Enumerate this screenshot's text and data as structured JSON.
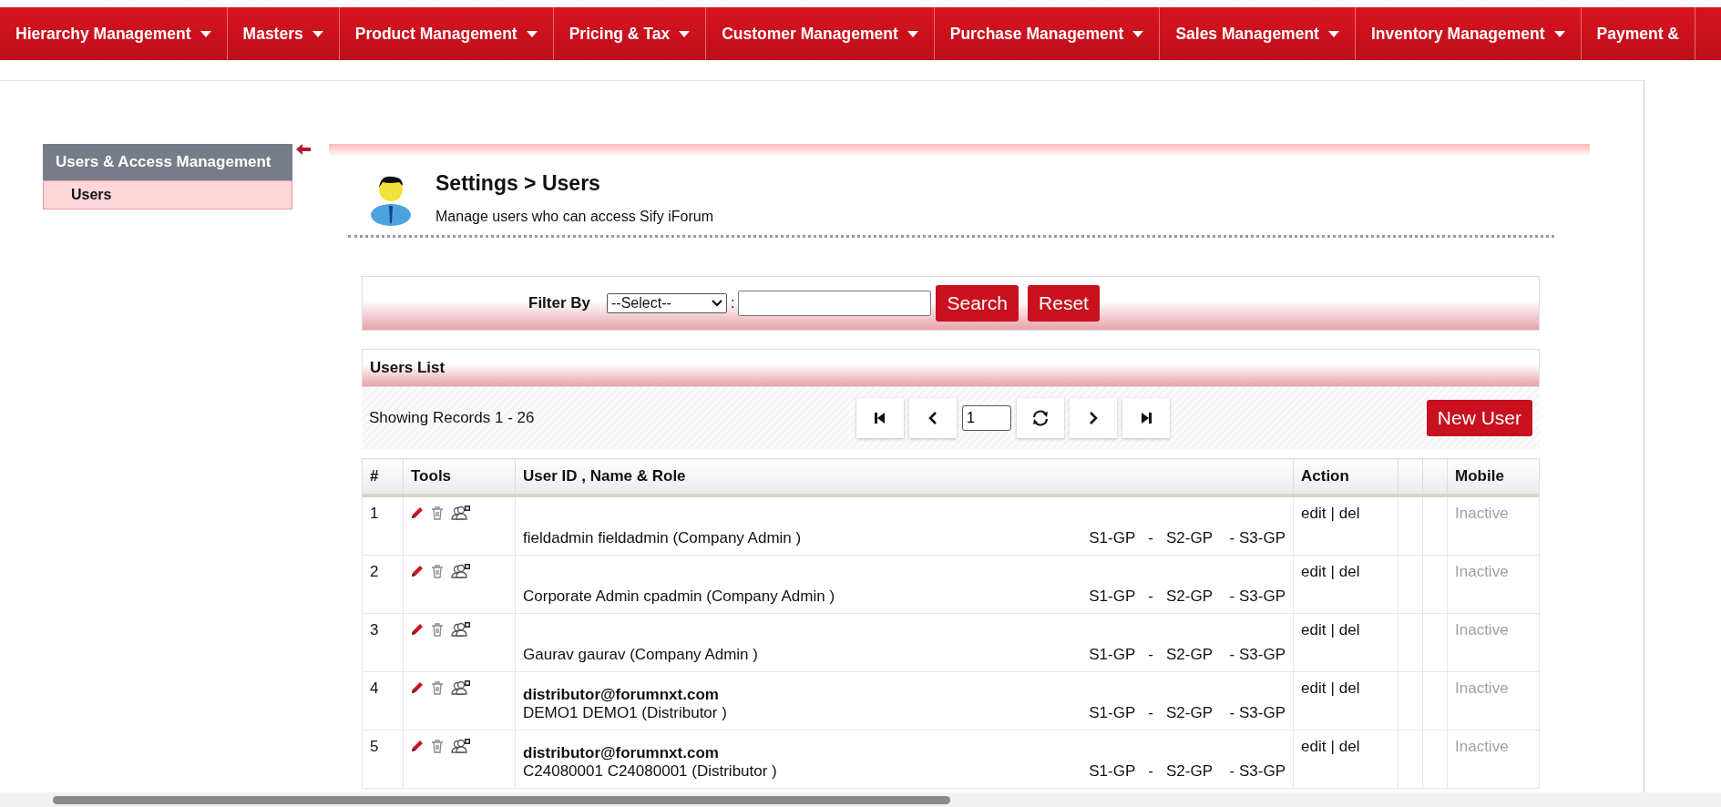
{
  "nav": [
    {
      "label": "Hierarchy Management",
      "caret": true
    },
    {
      "label": "Masters",
      "caret": true
    },
    {
      "label": "Product Management",
      "caret": true
    },
    {
      "label": "Pricing & Tax",
      "caret": true
    },
    {
      "label": "Customer Management",
      "caret": true
    },
    {
      "label": "Purchase Management",
      "caret": true
    },
    {
      "label": "Sales Management",
      "caret": true
    },
    {
      "label": "Inventory Management",
      "caret": true
    },
    {
      "label": "Payment &",
      "caret": false
    }
  ],
  "sidebar": {
    "title": "Users & Access Management",
    "items": [
      {
        "label": "Users",
        "selected": true
      }
    ]
  },
  "header": {
    "title": "Settings > Users",
    "subtitle": "Manage users who can access Sify iForum"
  },
  "filter": {
    "label": "Filter By",
    "select": "--Select--",
    "separator": ":",
    "search_button": "Search",
    "reset_button": "Reset"
  },
  "users_list": {
    "title": "Users List",
    "records": "Showing Records 1 - 26",
    "page": "1",
    "new_button": "New User",
    "columns": [
      {
        "kind": "num",
        "label": "#"
      },
      {
        "kind": "tools",
        "label": "Tools"
      },
      {
        "kind": "user",
        "label": "User ID , Name & Role"
      },
      {
        "kind": "action",
        "label": "Action"
      },
      {
        "kind": "blank"
      },
      {
        "kind": "blank"
      },
      {
        "kind": "mobile",
        "label": "Mobile"
      }
    ],
    "rows": [
      {
        "no": "1",
        "name_role": "fieldadmin fieldadmin (Company Admin )",
        "groups": "S1-GP   -   S2-GP    - S3-GP",
        "actions": [
          "edit",
          "del"
        ],
        "separator": "|",
        "mobile": "Inactive"
      },
      {
        "no": "2",
        "name_role": "Corporate Admin cpadmin (Company Admin )",
        "groups": "S1-GP   -   S2-GP    - S3-GP",
        "actions": [
          "edit",
          "del"
        ],
        "separator": "|",
        "mobile": "Inactive"
      },
      {
        "no": "3",
        "name_role": "Gaurav gaurav (Company Admin )",
        "groups": "S1-GP   -   S2-GP    - S3-GP",
        "actions": [
          "edit",
          "del"
        ],
        "separator": "|",
        "mobile": "Inactive"
      },
      {
        "no": "4",
        "user_id": "distributor@forumnxt.com",
        "name_role": "DEMO1 DEMO1 (Distributor )",
        "groups": "S1-GP   -   S2-GP    - S3-GP",
        "actions": [
          "edit",
          "del"
        ],
        "separator": "|",
        "mobile": "Inactive"
      },
      {
        "no": "5",
        "user_id": "distributor@forumnxt.com",
        "name_role": "C24080001 C24080001 (Distributor )",
        "groups": "S1-GP   -   S2-GP    - S3-GP",
        "actions": [
          "edit",
          "del"
        ],
        "separator": "|",
        "mobile": "Inactive"
      }
    ]
  }
}
